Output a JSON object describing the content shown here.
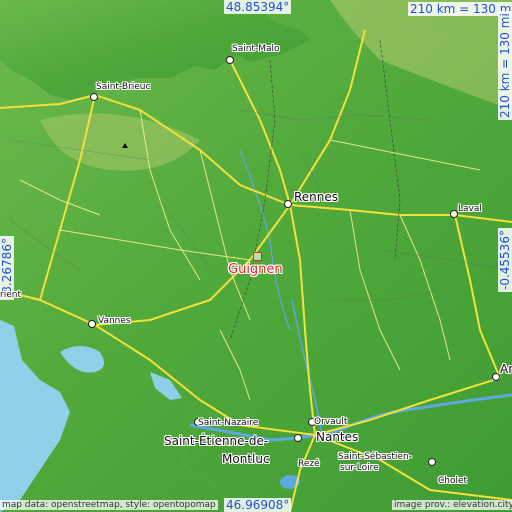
{
  "map": {
    "colors": {
      "sea": "#8fd0e8",
      "land": "#4fa83a",
      "roads": "#f2e13a",
      "water": "#5fa7df",
      "accent": "#e8242c",
      "coord": "#1f4fd8"
    },
    "coords": {
      "top_lat": "48.85394°",
      "bottom_lat": "46.96908°",
      "left_lon": "-3.26786°",
      "right_lon": "-0.45536°"
    },
    "scale": {
      "top": "210 km = 130 mi",
      "side": "210 km = 130 mi"
    },
    "highlight": {
      "name": "Guignen"
    },
    "places": {
      "saint_malo": "Saint-Malo",
      "saint_brieuc": "Saint-Brieuc",
      "rennes": "Rennes",
      "laval": "Laval",
      "vannes": "Vannes",
      "orient": "rient",
      "saint_nazaire": "Saint-Nazaire",
      "saint_etienne_1": "Saint-Étienne-de-",
      "saint_etienne_2": "Montluc",
      "orvault": "Orvault",
      "nantes": "Nantes",
      "saint_sebastien_1": "Saint-Sébastien-",
      "saint_sebastien_2": "sur-Loire",
      "reze": "Rezé",
      "cholet": "Cholet",
      "angers_partial": "Ar"
    },
    "credits": {
      "left": "map data: openstreetmap, style: opentopomap",
      "right": "image prov.: elevation.city"
    }
  }
}
